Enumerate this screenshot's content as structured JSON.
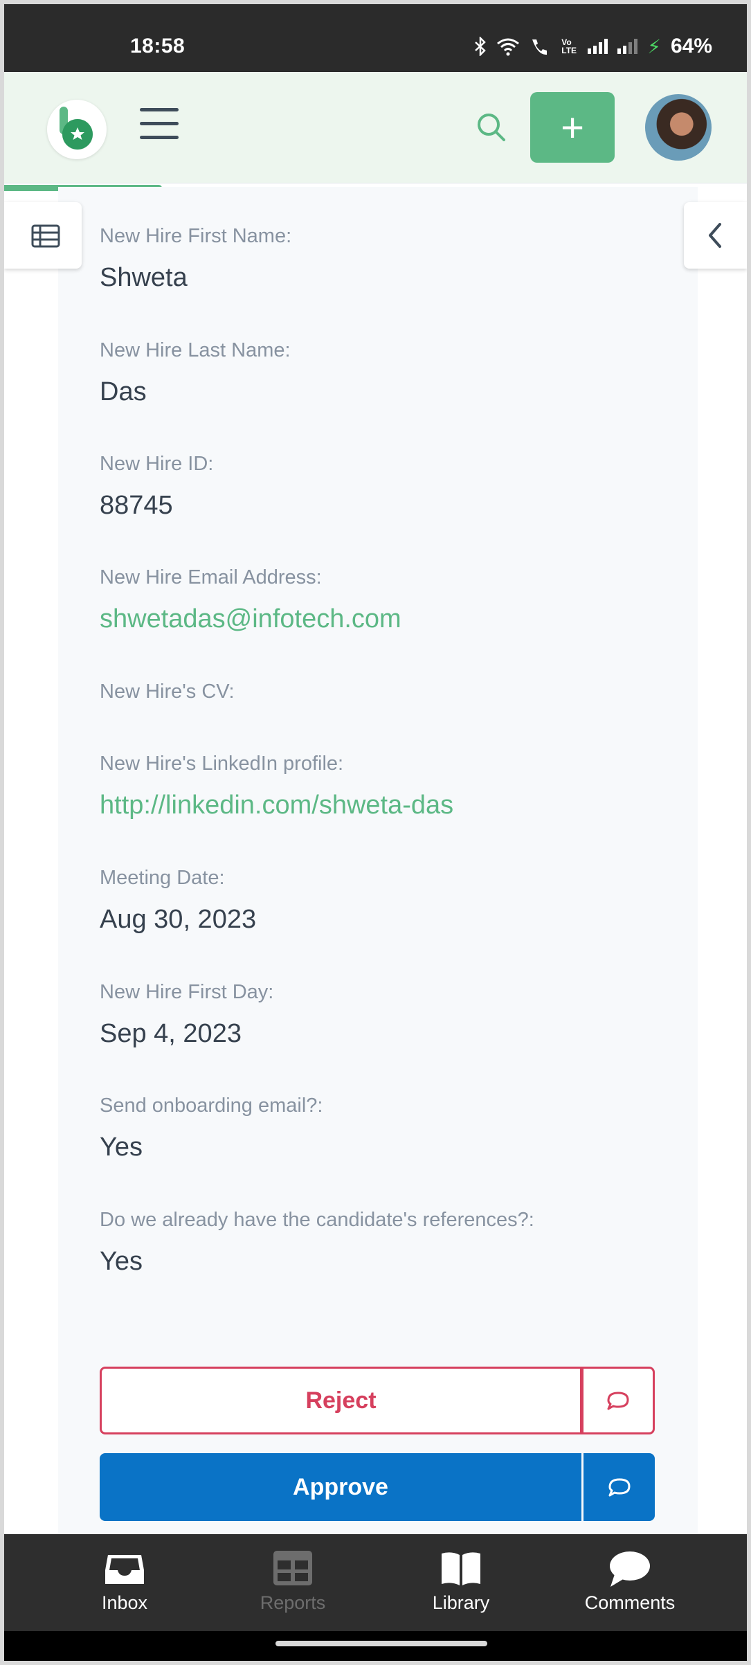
{
  "status_bar": {
    "time": "18:58",
    "battery": "64%",
    "icons": [
      "bluetooth-icon",
      "wifi-icon",
      "wifi-call-icon",
      "volte-icon",
      "signal-icon",
      "signal-icon",
      "charging-icon"
    ],
    "volte_text": "Vo LTE"
  },
  "header": {
    "logo": "b",
    "add_label": "+"
  },
  "colors": {
    "brand_green": "#5cb885",
    "reject_red": "#d6405e",
    "approve_blue": "#0a73c6",
    "label_gray": "#8792a0",
    "value_dark": "#36414e"
  },
  "fields": [
    {
      "label": "New Hire First Name:",
      "value": "Shweta",
      "is_link": false
    },
    {
      "label": "New Hire Last Name:",
      "value": "Das",
      "is_link": false
    },
    {
      "label": "New Hire ID:",
      "value": "88745",
      "is_link": false
    },
    {
      "label": "New Hire Email Address:",
      "value": "shwetadas@infotech.com",
      "is_link": true
    },
    {
      "label": "New Hire's CV:",
      "value": "",
      "is_link": false
    },
    {
      "label": "New Hire's LinkedIn profile:",
      "value": "http://linkedin.com/shweta-das",
      "is_link": true
    },
    {
      "label": "Meeting Date:",
      "value": "Aug 30, 2023",
      "is_link": false
    },
    {
      "label": "New Hire First Day:",
      "value": "Sep 4, 2023",
      "is_link": false
    },
    {
      "label": "Send onboarding email?:",
      "value": "Yes",
      "is_link": false
    },
    {
      "label": "Do we already have the candidate's references?:",
      "value": "Yes",
      "is_link": false
    }
  ],
  "actions": {
    "reject_label": "Reject",
    "approve_label": "Approve"
  },
  "bottom_nav": [
    {
      "label": "Inbox",
      "icon": "inbox-icon",
      "active": true
    },
    {
      "label": "Reports",
      "icon": "reports-icon",
      "active": false
    },
    {
      "label": "Library",
      "icon": "book-icon",
      "active": true
    },
    {
      "label": "Comments",
      "icon": "comment-bubble-icon",
      "active": true
    }
  ]
}
